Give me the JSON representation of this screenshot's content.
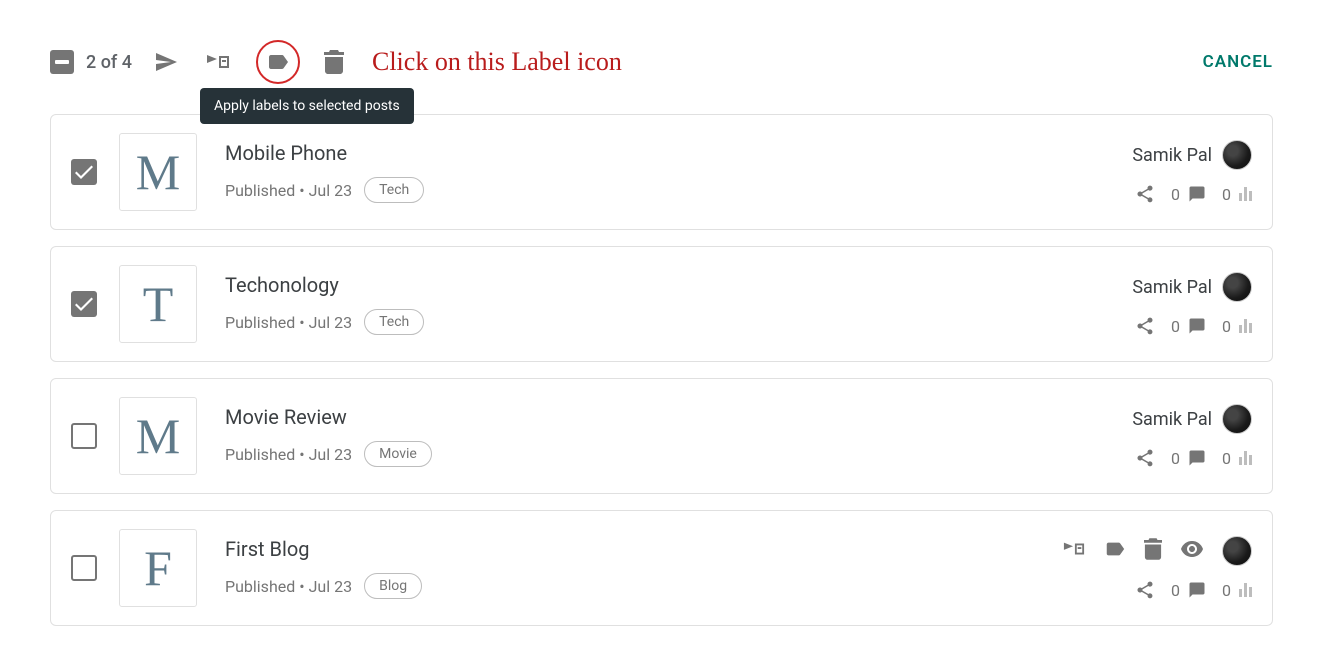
{
  "toolbar": {
    "count_text": "2 of 4",
    "cancel_label": "CANCEL",
    "tooltip_text": "Apply labels to selected posts"
  },
  "annotation": {
    "text": "Click on this Label icon"
  },
  "posts": [
    {
      "checked": true,
      "letter": "M",
      "title": "Mobile Phone",
      "status": "Published",
      "date": "Jul 23",
      "label": "Tech",
      "author": "Samik Pal",
      "comments": "0",
      "views": "0",
      "show_hover_actions": false
    },
    {
      "checked": true,
      "letter": "T",
      "title": "Techonology",
      "status": "Published",
      "date": "Jul 23",
      "label": "Tech",
      "author": "Samik Pal",
      "comments": "0",
      "views": "0",
      "show_hover_actions": false
    },
    {
      "checked": false,
      "letter": "M",
      "title": "Movie Review",
      "status": "Published",
      "date": "Jul 23",
      "label": "Movie",
      "author": "Samik Pal",
      "comments": "0",
      "views": "0",
      "show_hover_actions": false
    },
    {
      "checked": false,
      "letter": "F",
      "title": "First Blog",
      "status": "Published",
      "date": "Jul 23",
      "label": "Blog",
      "author": "Samik Pal",
      "comments": "0",
      "views": "0",
      "show_hover_actions": true
    }
  ]
}
